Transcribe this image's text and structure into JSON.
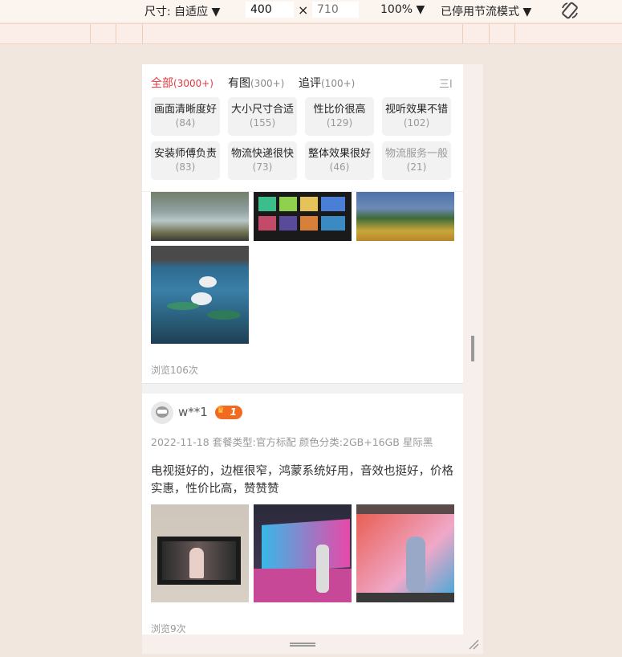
{
  "toolbar": {
    "size_label": "尺寸: 自适应 ▼",
    "width": "400",
    "times": "×",
    "height_placeholder": "710",
    "zoom": "100% ▼",
    "throttle": "已停用节流模式 ▼",
    "rotate_icon": "rotate-icon"
  },
  "tabs": [
    {
      "label": "全部",
      "count": "(3000+)",
      "active": true
    },
    {
      "label": "有图",
      "count": "(300+)"
    },
    {
      "label": "追评",
      "count": "(100+)"
    }
  ],
  "tabs_menu_glyph": "三l",
  "tags": [
    {
      "label": "画面清晰度好",
      "count": "(84)"
    },
    {
      "label": "大小尺寸合适",
      "count": "(155)"
    },
    {
      "label": "性比价很高",
      "count": "(129)"
    },
    {
      "label": "视听效果不错",
      "count": "(102)"
    },
    {
      "label": "安装师傅负责",
      "count": "(83)"
    },
    {
      "label": "物流快递很快",
      "count": "(73)"
    },
    {
      "label": "整体效果很好",
      "count": "(46)"
    },
    {
      "label": "物流服务一般",
      "count": "(21)",
      "negative": true
    }
  ],
  "review1": {
    "views": "浏览106次"
  },
  "review2": {
    "user": "w**1",
    "level": "1",
    "meta": "2022-11-18 套餐类型:官方标配 颜色分类:2GB+16GB 星际黑",
    "text": "电视挺好的，边框很窄，鸿蒙系统好用，音效也挺好，价格实惠，性价比高，赞赞赞",
    "views": "浏览9次"
  },
  "colors": {
    "accent": "#e4393c",
    "badge": "#f26a1f"
  }
}
